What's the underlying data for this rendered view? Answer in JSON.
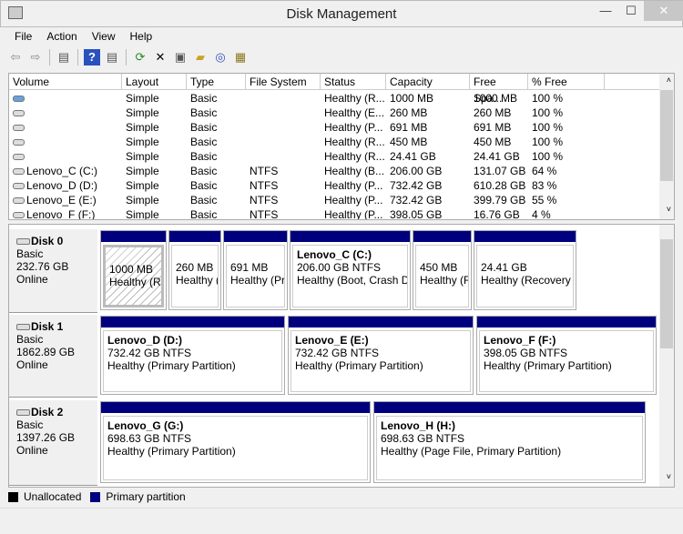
{
  "window": {
    "title": "Disk Management",
    "minimize": "—",
    "maximize": "☐",
    "close": "✕"
  },
  "menu": [
    "File",
    "Action",
    "View",
    "Help"
  ],
  "toolbar": [
    "back-icon",
    "forward-icon",
    "console-tree-icon",
    "help-icon",
    "action-pane-icon",
    "refresh-icon",
    "delete-icon",
    "properties-icon",
    "open-icon",
    "explore-icon",
    "settings-icon"
  ],
  "columns": [
    "Volume",
    "Layout",
    "Type",
    "File System",
    "Status",
    "Capacity",
    "Free Spa...",
    "% Free"
  ],
  "volumes": [
    [
      "",
      "Simple",
      "Basic",
      "",
      "Healthy (R...",
      "1000 MB",
      "1000 MB",
      "100 %"
    ],
    [
      "",
      "Simple",
      "Basic",
      "",
      "Healthy (E...",
      "260 MB",
      "260 MB",
      "100 %"
    ],
    [
      "",
      "Simple",
      "Basic",
      "",
      "Healthy (P...",
      "691 MB",
      "691 MB",
      "100 %"
    ],
    [
      "",
      "Simple",
      "Basic",
      "",
      "Healthy (R...",
      "450 MB",
      "450 MB",
      "100 %"
    ],
    [
      "",
      "Simple",
      "Basic",
      "",
      "Healthy (R...",
      "24.41 GB",
      "24.41 GB",
      "100 %"
    ],
    [
      "Lenovo_C (C:)",
      "Simple",
      "Basic",
      "NTFS",
      "Healthy (B...",
      "206.00 GB",
      "131.07 GB",
      "64 %"
    ],
    [
      "Lenovo_D (D:)",
      "Simple",
      "Basic",
      "NTFS",
      "Healthy (P...",
      "732.42 GB",
      "610.28 GB",
      "83 %"
    ],
    [
      "Lenovo_E (E:)",
      "Simple",
      "Basic",
      "NTFS",
      "Healthy (P...",
      "732.42 GB",
      "399.79 GB",
      "55 %"
    ],
    [
      "Lenovo_F (F:)",
      "Simple",
      "Basic",
      "NTFS",
      "Healthy (P...",
      "398.05 GB",
      "16.76 GB",
      "4 %"
    ]
  ],
  "disks": [
    {
      "name": "Disk 0",
      "type": "Basic",
      "size": "232.76 GB",
      "status": "Online",
      "partitions": [
        {
          "label": "",
          "size": "1000 MB",
          "status": "Healthy (Rec"
        },
        {
          "label": "",
          "size": "260 MB",
          "status": "Healthy ("
        },
        {
          "label": "",
          "size": "691 MB",
          "status": "Healthy (Pr"
        },
        {
          "label": "Lenovo_C  (C:)",
          "size": "206.00 GB NTFS",
          "status": "Healthy (Boot, Crash Du"
        },
        {
          "label": "",
          "size": "450 MB",
          "status": "Healthy (R"
        },
        {
          "label": "",
          "size": "24.41 GB",
          "status": "Healthy (Recovery P"
        }
      ]
    },
    {
      "name": "Disk 1",
      "type": "Basic",
      "size": "1862.89 GB",
      "status": "Online",
      "partitions": [
        {
          "label": "Lenovo_D  (D:)",
          "size": "732.42 GB NTFS",
          "status": "Healthy (Primary Partition)"
        },
        {
          "label": "Lenovo_E  (E:)",
          "size": "732.42 GB NTFS",
          "status": "Healthy (Primary Partition)"
        },
        {
          "label": "Lenovo_F  (F:)",
          "size": "398.05 GB NTFS",
          "status": "Healthy (Primary Partition)"
        }
      ]
    },
    {
      "name": "Disk 2",
      "type": "Basic",
      "size": "1397.26 GB",
      "status": "Online",
      "partitions": [
        {
          "label": "Lenovo_G  (G:)",
          "size": "698.63 GB NTFS",
          "status": "Healthy (Primary Partition)"
        },
        {
          "label": "Lenovo_H  (H:)",
          "size": "698.63 GB NTFS",
          "status": "Healthy (Page File, Primary Partition)"
        }
      ]
    }
  ],
  "legend": [
    {
      "label": "Unallocated",
      "color": "#000000"
    },
    {
      "label": "Primary partition",
      "color": "#00007f"
    }
  ]
}
